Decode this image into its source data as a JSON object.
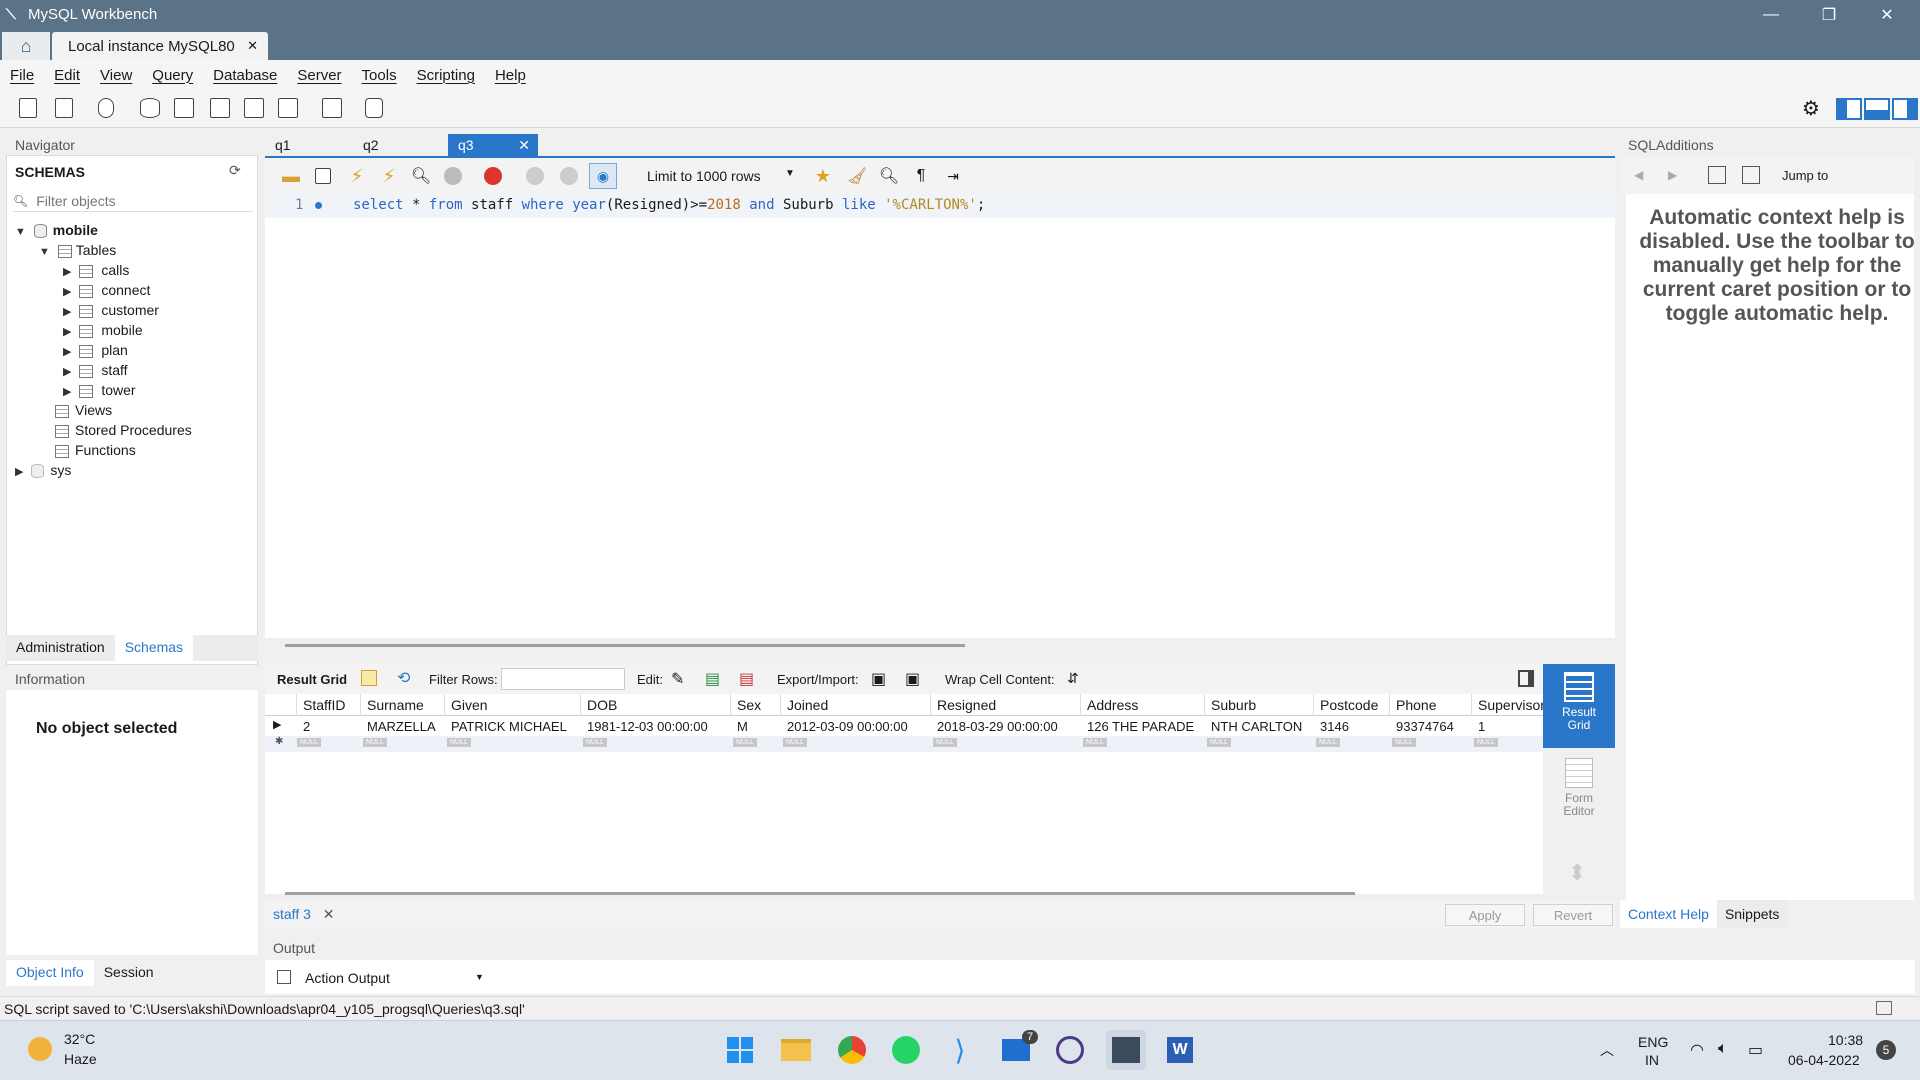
{
  "window": {
    "title": "MySQL Workbench"
  },
  "connection_tab": {
    "label": "Local instance MySQL80"
  },
  "menu": [
    "File",
    "Edit",
    "View",
    "Query",
    "Database",
    "Server",
    "Tools",
    "Scripting",
    "Help"
  ],
  "navigator": {
    "header": "Navigator",
    "schemas_label": "SCHEMAS",
    "filter_placeholder": "Filter objects",
    "db_mobile": "mobile",
    "tables_label": "Tables",
    "tables": [
      "calls",
      "connect",
      "customer",
      "mobile",
      "plan",
      "staff",
      "tower"
    ],
    "views": "Views",
    "procs": "Stored Procedures",
    "funcs": "Functions",
    "db_sys": "sys"
  },
  "nav_tabs": {
    "admin": "Administration",
    "schemas": "Schemas"
  },
  "info": {
    "header": "Information",
    "message": "No object selected"
  },
  "bottom_tabs": {
    "object_info": "Object Info",
    "session": "Session"
  },
  "query_tabs": [
    "q1",
    "q2",
    "q3"
  ],
  "editor_toolbar": {
    "limit": "Limit to 1000 rows"
  },
  "editor": {
    "line_no": "1",
    "sql": {
      "k1": "select",
      "p1": " * ",
      "k2": "from",
      "p2": " staff ",
      "k3": "where",
      "p3": " ",
      "k4": "year",
      "p4": "(Resigned)>=",
      "n1": "2018",
      "p5": " ",
      "k5": "and",
      "p6": " Suburb ",
      "k6": "like",
      "p7": " ",
      "s1": "'%CARLTON%'",
      "p8": ";"
    }
  },
  "result_toolbar": {
    "grid_label": "Result Grid",
    "filter_label": "Filter Rows:",
    "edit_label": "Edit:",
    "export_label": "Export/Import:",
    "wrap_label": "Wrap Cell Content:"
  },
  "grid": {
    "columns": [
      "StaffID",
      "Surname",
      "Given",
      "DOB",
      "Sex",
      "Joined",
      "Resigned",
      "Address",
      "Suburb",
      "Postcode",
      "Phone",
      "Supervisor"
    ],
    "rows": [
      [
        "2",
        "MARZELLA",
        "PATRICK MICHAEL",
        "1981-12-03 00:00:00",
        "M",
        "2012-03-09 00:00:00",
        "2018-03-29 00:00:00",
        "126 THE PARADE",
        "NTH CARLTON",
        "3146",
        "93374764",
        "1"
      ]
    ],
    "null_label": "NULL"
  },
  "side_views": {
    "result_grid": "Result Grid",
    "form_editor": "Form Editor"
  },
  "result_tab": {
    "label": "staff 3"
  },
  "actions": {
    "apply": "Apply",
    "revert": "Revert"
  },
  "output": {
    "header": "Output",
    "selector": "Action Output"
  },
  "sql_additions": {
    "header": "SQLAdditions",
    "jump": "Jump to",
    "help_text": "Automatic context help is disabled. Use the toolbar to manually get help for the current caret position or to toggle automatic help.",
    "tab_context": "Context Help",
    "tab_snippets": "Snippets"
  },
  "status": {
    "text": "SQL script saved to 'C:\\Users\\akshi\\Downloads\\apr04_y105_progsql\\Queries\\q3.sql'"
  },
  "taskbar": {
    "temp": "32°C",
    "weather": "Haze",
    "lang1": "ENG",
    "lang2": "IN",
    "time": "10:38",
    "date": "06-04-2022",
    "badge": "7",
    "notif": "5"
  },
  "colors": {
    "accent": "#2a77c9",
    "titlebar": "#5a7386"
  }
}
